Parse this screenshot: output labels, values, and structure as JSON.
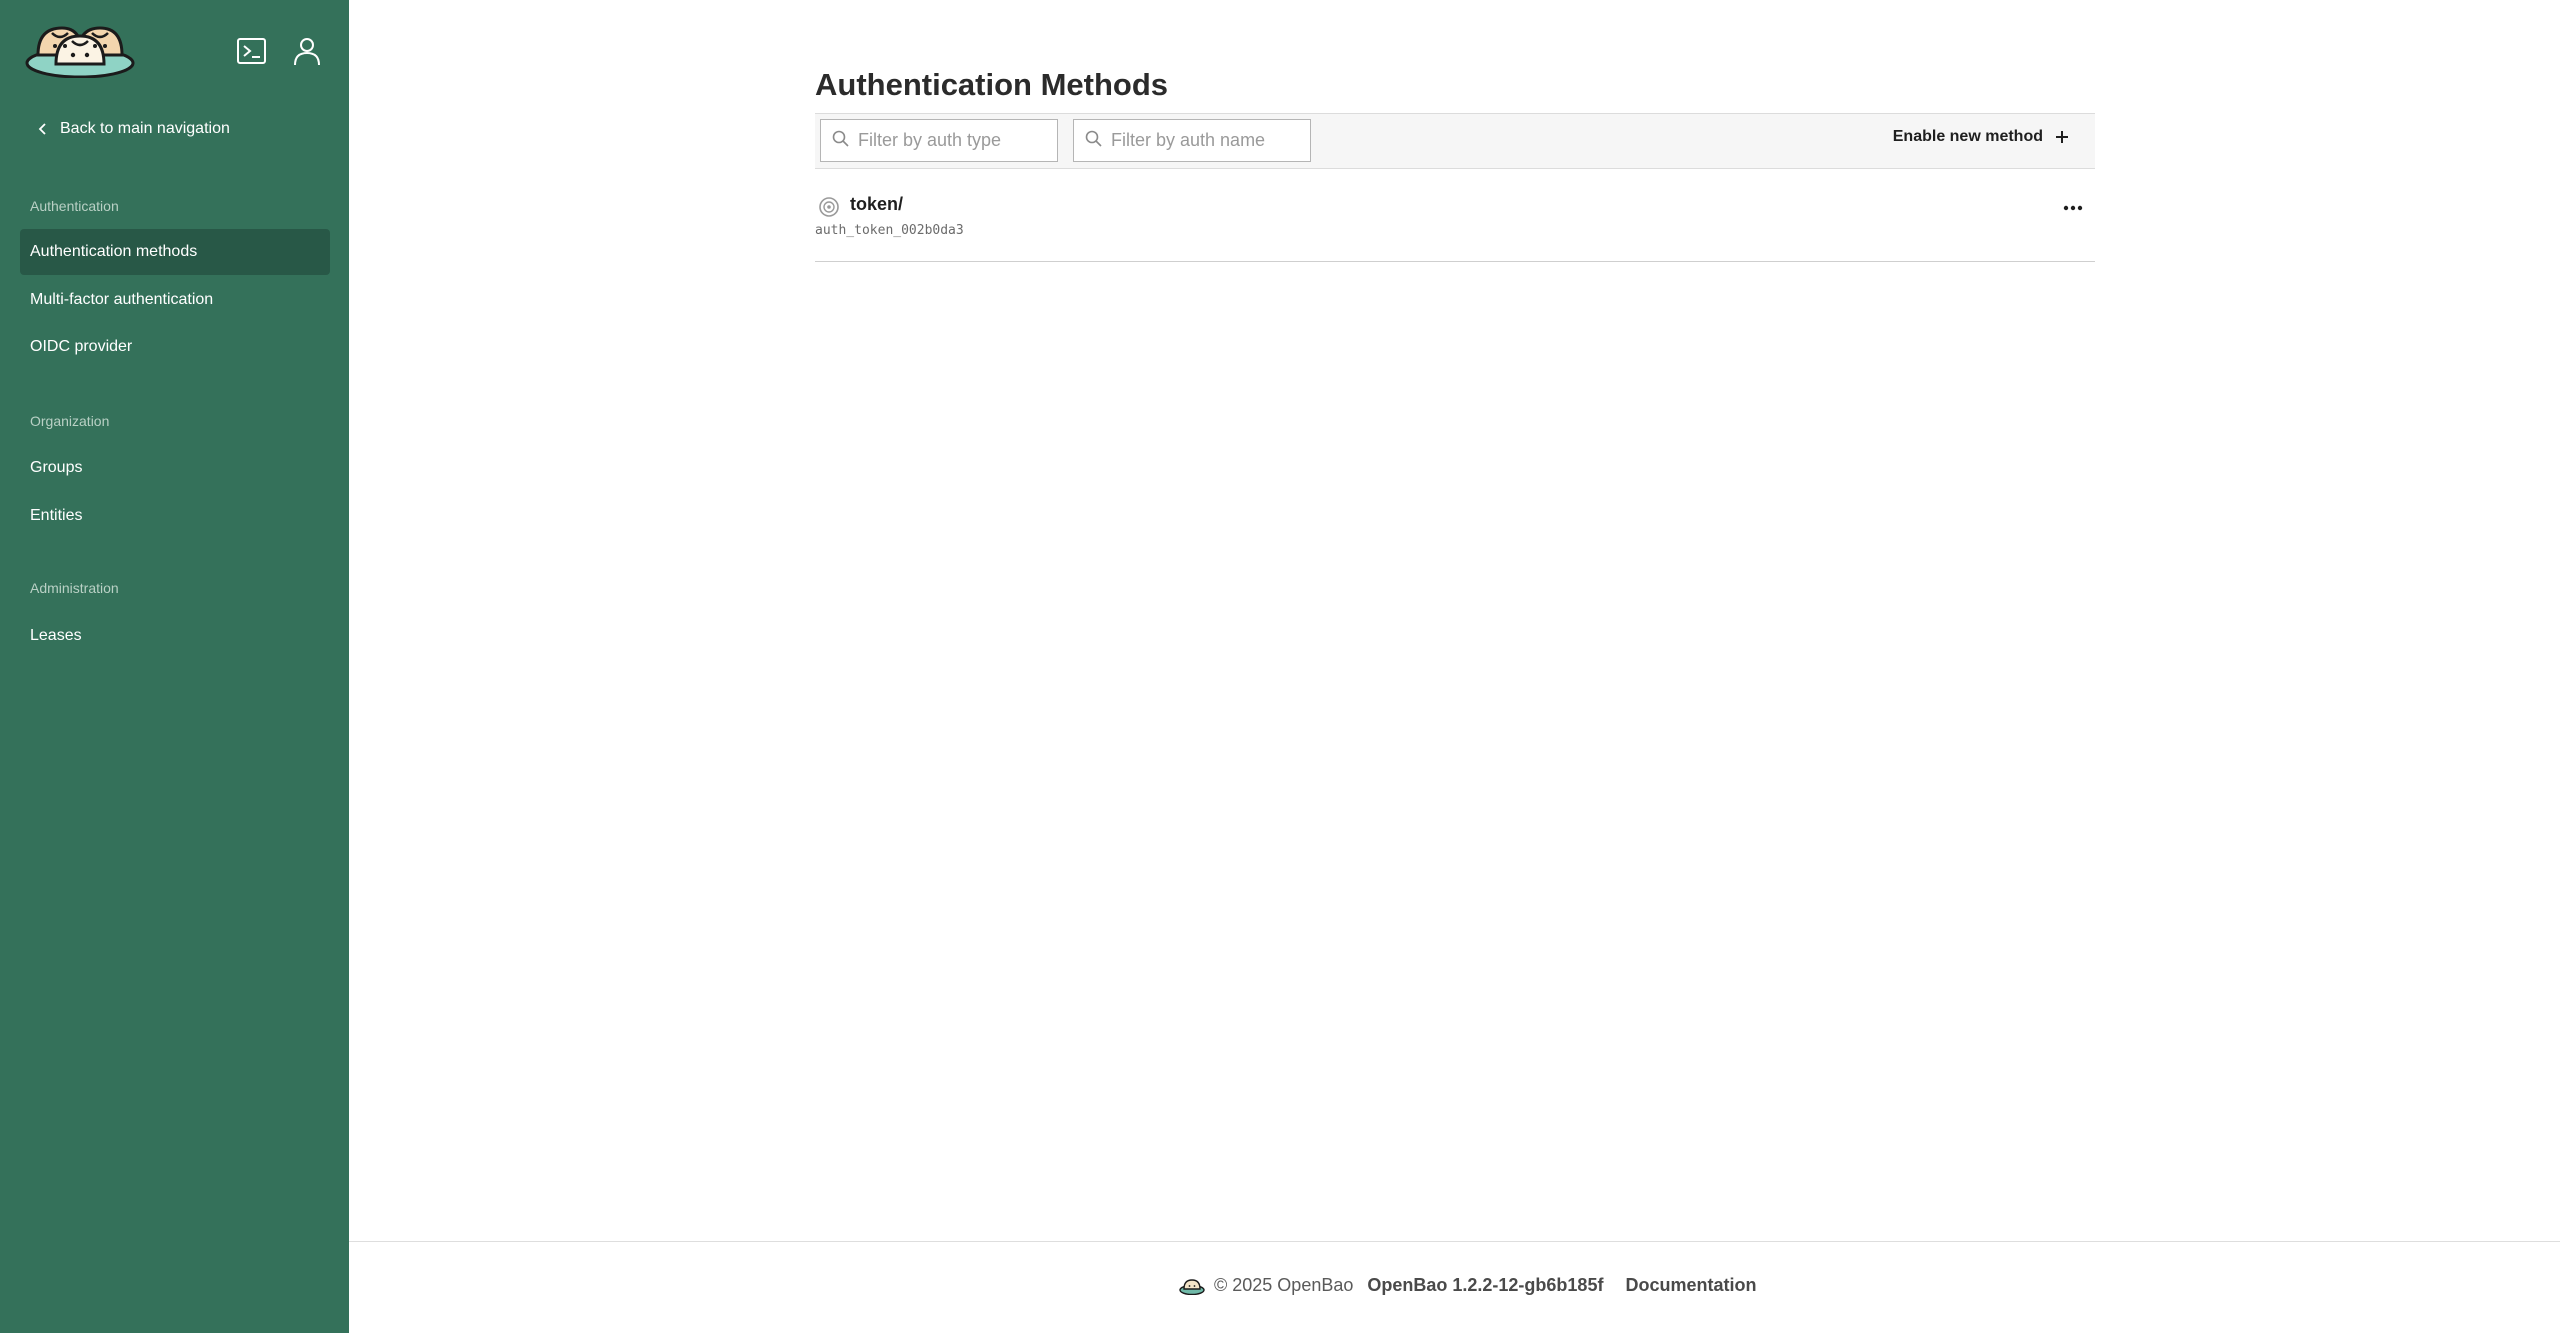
{
  "sidebar": {
    "back_link": "Back to main navigation",
    "sections": [
      {
        "label": "Authentication",
        "items": [
          "Authentication methods",
          "Multi-factor authentication",
          "OIDC provider"
        ]
      },
      {
        "label": "Organization",
        "items": [
          "Groups",
          "Entities"
        ]
      },
      {
        "label": "Administration",
        "items": [
          "Leases"
        ]
      }
    ],
    "active_item": "Authentication methods",
    "icons": [
      "terminal-icon",
      "user-icon"
    ]
  },
  "main": {
    "title": "Authentication Methods",
    "filters": {
      "type_placeholder": "Filter by auth type",
      "name_placeholder": "Filter by auth name"
    },
    "enable_label": "Enable new method",
    "methods": [
      {
        "path": "token/",
        "accessor": "auth_token_002b0da3",
        "icon": "token-icon"
      }
    ]
  },
  "footer": {
    "copyright": "© 2025 OpenBao",
    "version": "OpenBao 1.2.2-12-gb6b185f",
    "docs": "Documentation"
  },
  "colors": {
    "sidebar_bg": "#34715a",
    "sidebar_active": "#285847"
  }
}
